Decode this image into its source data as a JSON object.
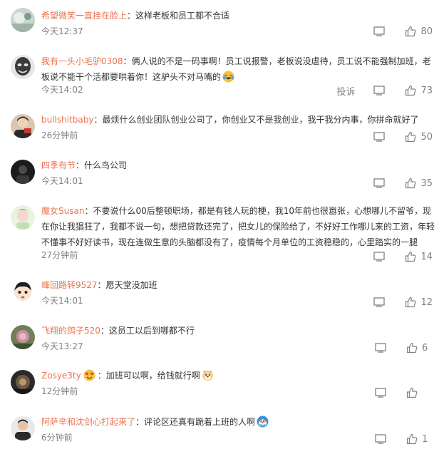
{
  "comments": [
    {
      "user": "希望微笑一直挂在脸上",
      "text": "这样老板和员工都不合适",
      "time": "今天12:37",
      "likes": "80",
      "avatar": "avatar-1"
    },
    {
      "user": "我有一头小毛驴0308",
      "text": "俩人说的不是一码事啊！员工说报警，老板说没虐待，员工说不能强制加班，老板说不能干个活都要哄着你！这驴头不对马嘴的",
      "time": "今天14:02",
      "likes": "73",
      "report": "投诉",
      "emoji": "laugh-cry-emoji",
      "avatar": "avatar-2"
    },
    {
      "user": "bullshitbaby",
      "text": "最烦什么创业团队创业公司了，你创业又不是我创业，我干我分内事，你拼命就好了",
      "time": "26分钟前",
      "likes": "50",
      "avatar": "avatar-3"
    },
    {
      "user": "四季有节",
      "text": "什么鸟公司",
      "time": "今天14:01",
      "likes": "35",
      "avatar": "avatar-4"
    },
    {
      "user": "魔女Susan",
      "text": "不要说什么00后整顿职场，都是有钱人玩的梗，我10年前也很嚣张，心想哪儿不留爷，现在你让我猖狂了，我都不说一句，想把贷款还完了，把女儿的保险给了，不好好工作哪儿来的工资，年轻不懂事不好好读书，现在连做生意的头脑都没有了，疫情每个月单位的工资稳稳的，心里踏实的一腿",
      "time": "27分钟前",
      "likes": "14",
      "avatar": "avatar-5"
    },
    {
      "user": "峰回路转9527",
      "text": "愿天堂没加班",
      "time": "今天14:01",
      "likes": "12",
      "avatar": "avatar-6"
    },
    {
      "user": "飞翔的鸽子520",
      "text": "这员工以后到哪都不行",
      "time": "今天13:27",
      "likes": "6",
      "avatar": "avatar-7"
    },
    {
      "user": "Zosye3ty",
      "text": "加班可以啊，给钱就行啊",
      "time": "12分钟前",
      "likes": "",
      "emoji_before": "heart-eyes-emoji",
      "emoji": "doge-emoji",
      "avatar": "avatar-8"
    },
    {
      "user": "阿萨辛和沈剑心打起来了",
      "text": "评论区还真有跪着上班的人啊",
      "time": "6分钟前",
      "likes": "1",
      "emoji": "doge-blue-emoji",
      "avatar": "avatar-9"
    }
  ],
  "colors": {
    "username": "#eb7350",
    "text": "#333333",
    "meta": "#808080"
  }
}
